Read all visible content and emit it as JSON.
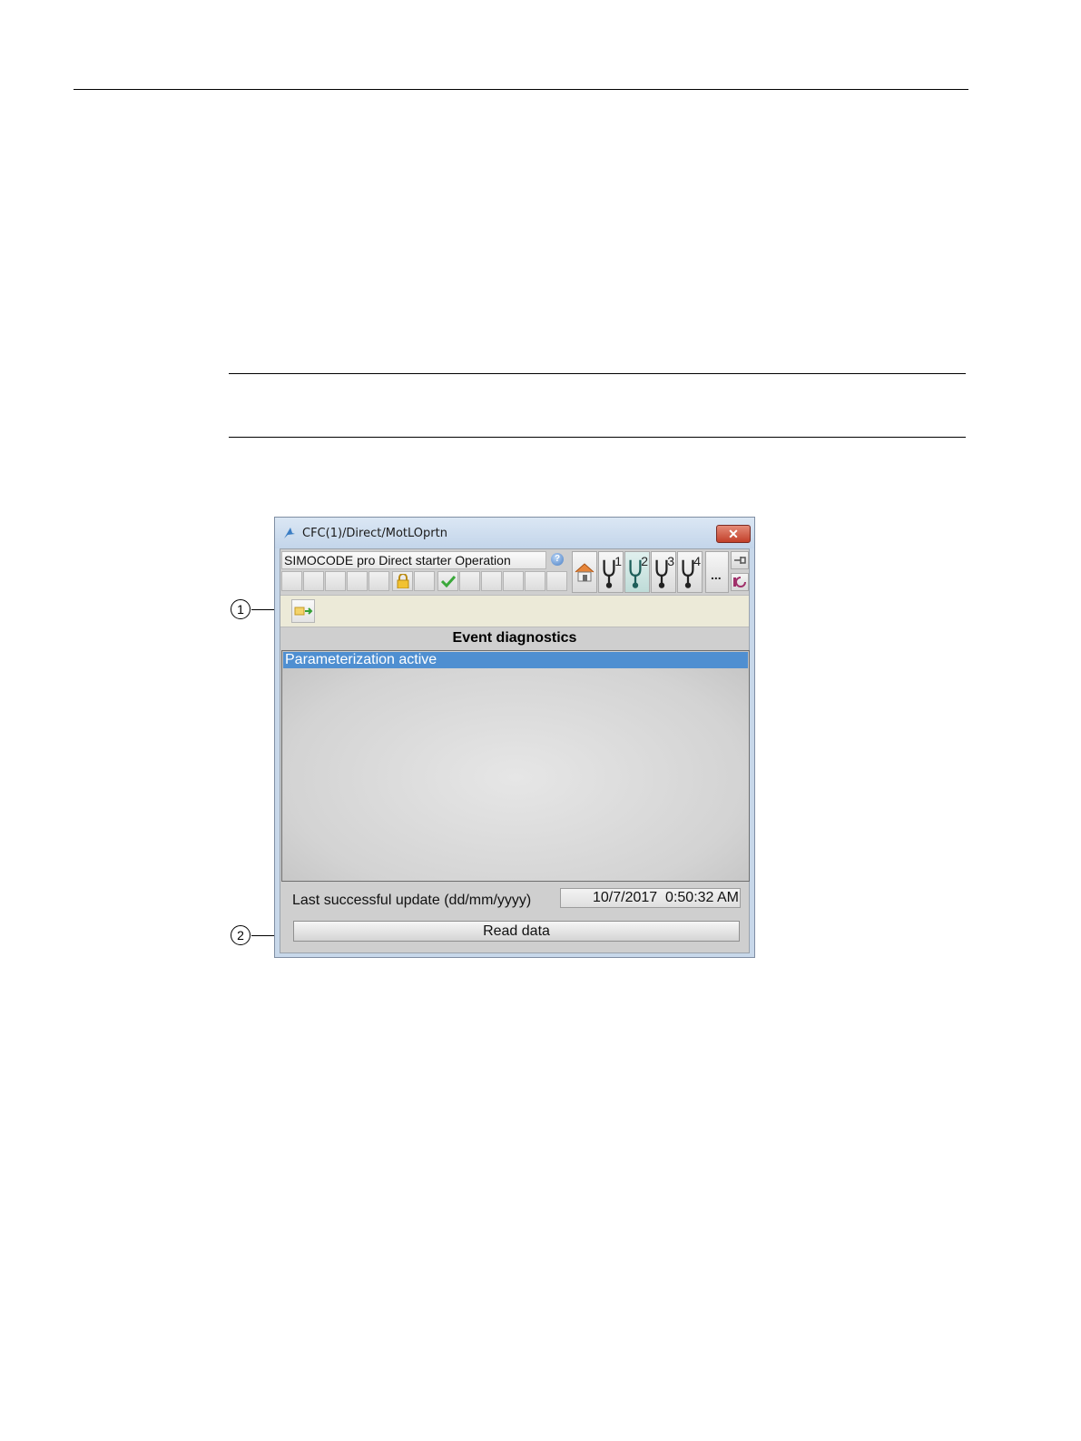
{
  "window": {
    "title": "CFC(1)/Direct/MotLOprtn",
    "close_icon": "close-icon"
  },
  "faceplate": {
    "name": "SIMOCODE pro Direct starter Operation",
    "help_icon": "?",
    "nav_views": [
      "1",
      "2",
      "3",
      "4"
    ],
    "more_label": "..."
  },
  "toolbar": {
    "button_icon": "export-to-view-icon"
  },
  "event_diagnostics": {
    "title": "Event diagnostics",
    "items": [
      "Parameterization active"
    ]
  },
  "footer": {
    "update_label": "Last successful update (dd/mm/yyyy)",
    "update_value": "10/7/2017  0:50:32 AM",
    "read_button": "Read data"
  },
  "callouts": [
    "1",
    "2"
  ],
  "colors": {
    "selection": "#4f8fd1",
    "titlebar": "#c3d5ea",
    "toolbar": "#ecead8"
  }
}
